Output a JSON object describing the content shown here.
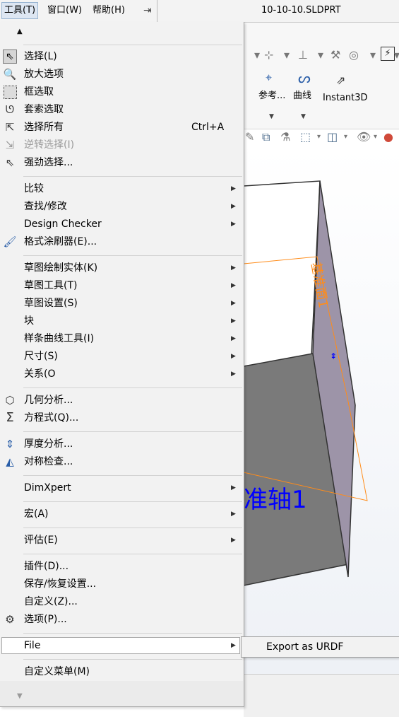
{
  "menubar": {
    "tools": "工具(T)",
    "window": "窗口(W)",
    "help": "帮助(H)",
    "pin_icon": "pin-icon"
  },
  "document_title": "10-10-10.SLDPRT",
  "command_manager": {
    "reference_label": "参考...",
    "curve_label": "曲线",
    "instant3d_label": "Instant3D"
  },
  "viewport": {
    "plane_label": "基准面1",
    "axis_label": "准轴1",
    "colors": {
      "plane": "#ff8c1a",
      "axis_text": "#0000ff",
      "box_dark": "#7a7a7a",
      "box_face": "#9d94a8"
    }
  },
  "menu": {
    "items": [
      {
        "label": "选择(L)",
        "icon": "select-arrow-icon"
      },
      {
        "label": "放大选项",
        "icon": "magnify-select-icon"
      },
      {
        "label": "框选取",
        "icon": "box-select-icon"
      },
      {
        "label": "套索选取",
        "icon": "lasso-icon"
      },
      {
        "label": "选择所有",
        "icon": "select-all-icon",
        "shortcut": "Ctrl+A"
      },
      {
        "label": "逆转选择(I)",
        "icon": "invert-selection-icon",
        "disabled": true
      },
      {
        "label": "强劲选择...",
        "icon": "power-select-icon"
      },
      {
        "label": "比较",
        "submenu": true
      },
      {
        "label": "查找/修改",
        "submenu": true
      },
      {
        "label": "Design Checker",
        "submenu": true
      },
      {
        "label": "格式涂刷器(E)...",
        "icon": "format-painter-icon"
      },
      {
        "label": "草图绘制实体(K)",
        "submenu": true
      },
      {
        "label": "草图工具(T)",
        "submenu": true
      },
      {
        "label": "草图设置(S)",
        "submenu": true
      },
      {
        "label": "块",
        "submenu": true
      },
      {
        "label": "样条曲线工具(I)",
        "submenu": true
      },
      {
        "label": "尺寸(S)",
        "submenu": true
      },
      {
        "label": "关系(O",
        "submenu": true
      },
      {
        "label": "几何分析...",
        "icon": "geometry-analysis-icon"
      },
      {
        "label": "方程式(Q)...",
        "icon": "sigma-icon"
      },
      {
        "label": "厚度分析...",
        "icon": "thickness-analysis-icon"
      },
      {
        "label": "对称检查...",
        "icon": "symmetry-check-icon"
      },
      {
        "label": "DimXpert",
        "submenu": true
      },
      {
        "label": "宏(A)",
        "submenu": true
      },
      {
        "label": "评估(E)",
        "submenu": true
      },
      {
        "label": "插件(D)..."
      },
      {
        "label": "保存/恢复设置..."
      },
      {
        "label": "自定义(Z)..."
      },
      {
        "label": "选项(P)...",
        "icon": "gear-icon"
      },
      {
        "label": "File",
        "submenu": true,
        "highlighted": true
      },
      {
        "label": "自定义菜单(M)"
      }
    ],
    "submenu_file": [
      "Export as URDF"
    ]
  }
}
